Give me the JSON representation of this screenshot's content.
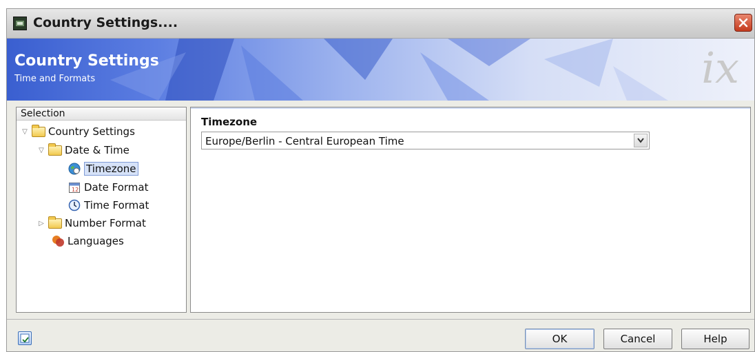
{
  "window": {
    "title": "Country Settings....",
    "close_icon": "close-icon"
  },
  "banner": {
    "title": "Country Settings",
    "subtitle": "Time and Formats",
    "logo": "ix"
  },
  "tree": {
    "header": "Selection",
    "items": [
      {
        "label": "Country Settings",
        "icon": "folder-icon",
        "expanded": true
      },
      {
        "label": "Date & Time",
        "icon": "folder-icon",
        "expanded": true
      },
      {
        "label": "Timezone",
        "icon": "globe-icon",
        "selected": true
      },
      {
        "label": "Date Format",
        "icon": "calendar-icon"
      },
      {
        "label": "Time Format",
        "icon": "clock-icon"
      },
      {
        "label": "Number Format",
        "icon": "folder-icon",
        "expanded": false
      },
      {
        "label": "Languages",
        "icon": "languages-icon"
      }
    ]
  },
  "main": {
    "field_label": "Timezone",
    "field_value": "Europe/Berlin - Central European Time"
  },
  "footer": {
    "icon": "info-icon",
    "buttons": {
      "ok": "OK",
      "cancel": "Cancel",
      "help": "Help"
    }
  },
  "colors": {
    "accent": "#3a5fd0",
    "selection": "#d6e2f8"
  }
}
